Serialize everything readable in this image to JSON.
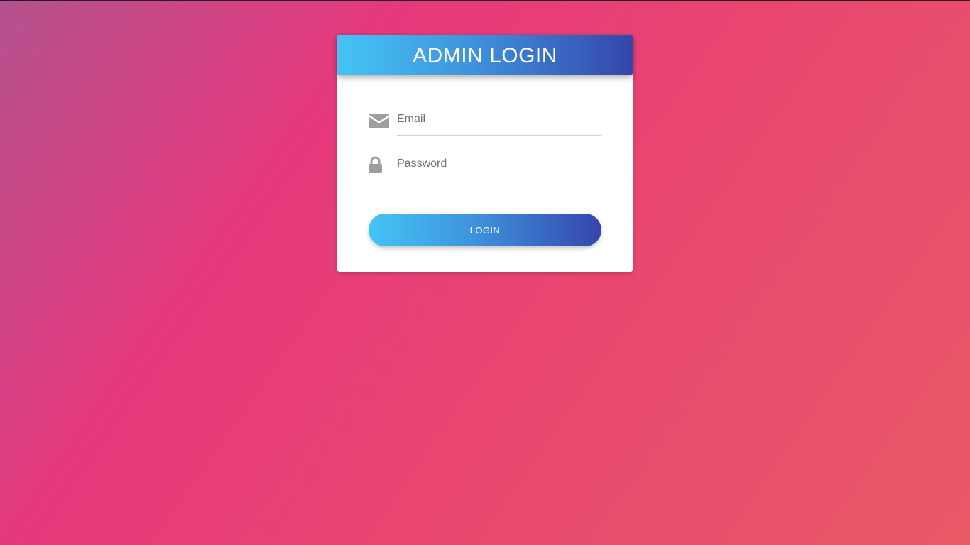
{
  "login_card": {
    "title": "ADMIN LOGIN",
    "email": {
      "placeholder": "Email",
      "value": "",
      "icon": "envelope-icon"
    },
    "password": {
      "placeholder": "Password",
      "value": "",
      "icon": "lock-icon"
    },
    "submit_label": "LOGIN"
  },
  "colors": {
    "gradient_start": "#44c4f5",
    "gradient_end": "#3446ab",
    "background_pink": "#e6397c",
    "icon_gray": "#9e9e9e"
  }
}
